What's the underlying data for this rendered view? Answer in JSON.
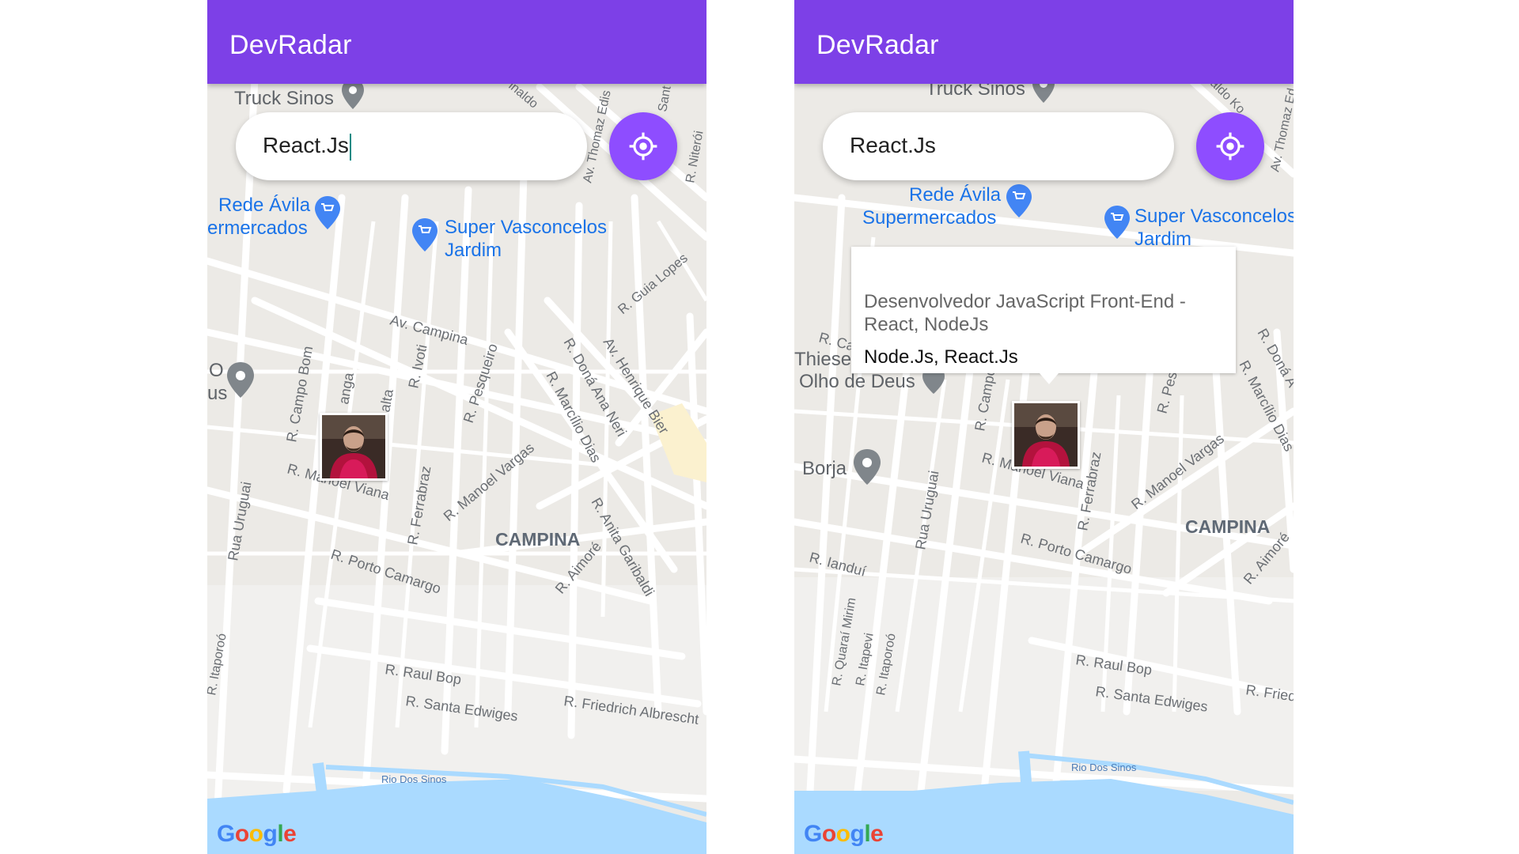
{
  "screens": [
    {
      "app_title": "DevRadar",
      "search_value": "React.Js",
      "search_focused": true,
      "map_labels": {
        "truck": "Truck Sinos",
        "rede_line1": "Rede Ávila",
        "rede_line2": "ermercados",
        "super_line1": "Super Vasconcelos",
        "super_line2": "Jardim",
        "av_campina": "Av. Campina",
        "campina": "CAMPINA",
        "porto_camargo": "R. Porto Camargo",
        "raul_bop": "R. Raul Bop",
        "santa_edwiges": "R. Santa Edwiges",
        "friedrich": "R. Friedrich Albrescht",
        "rio": "Rio Dos Sinos",
        "manoel_vargas": "R. Manoel Vargas",
        "guia_lopes": "R. Guia Lopes",
        "rua_uruguai": "Rua Uruguai",
        "campo_bom": "R. Campo Bom",
        "ferrabraz": "R. Ferrabraz",
        "pesqueiro": "R. Pesqueiro",
        "ivoti": "R. Ivoti",
        "dona_ana_neri": "R. Doná Ana Neri",
        "marcilio_dias": "R. Marcílio Dias",
        "henrique_bier": "Av. Henrique Bier",
        "anita_garibaldi": "R. Anita Garibaldi",
        "aimore": "R. Aimoré",
        "thomaz_edison": "Av. Thomaz Edis",
        "niteroi": "R. Niterói",
        "manoel_viana": "R. Manoel Viana",
        "taporoo": "R. Itaporoó",
        "olho_o": "O",
        "olho_us": "us",
        "anga": "anga",
        "alta": "alta",
        "sant": "Sant",
        "inaldo": "inaldo"
      }
    },
    {
      "app_title": "DevRadar",
      "search_value": "React.Js",
      "search_focused": false,
      "callout": {
        "bio": "Desenvolvedor JavaScript Front-End - React, NodeJs",
        "techs": "Node.Js, React.Js"
      },
      "map_labels": {
        "truck": "Truck Sinos",
        "rede_line1": "Rede Ávila",
        "rede_line2": "Supermercados",
        "super_line1": "Super Vasconcelos",
        "super_line2": "Jardim",
        "campina": "CAMPINA",
        "porto_camargo": "R. Porto Camargo",
        "raul_bop": "R. Raul Bop",
        "santa_edwiges": "R. Santa Edwiges",
        "rio": "Rio Dos Sinos",
        "manoel_vargas": "R. Manoel Vargas",
        "manoel_viana": "R. Manoel Viana",
        "rua_uruguai": "Rua Uruguai",
        "ferrabraz": "R. Ferrabraz",
        "landui": "R. Ianduí",
        "quarai_mirim": "R. Quaraí Mirim",
        "itapevi": "R. Itapevi",
        "itaporoo": "R. Itaporoó",
        "olho_de_deus": "Olho de Deus",
        "thiesen": "Thiesen",
        "borja": "Borja",
        "friedrich_short": "R. Fried",
        "aimore_short": "R. Aimoré",
        "dona_a": "R. Doná A",
        "marcilio_dias": "R. Marcílio Dias",
        "pes": "R. Pes",
        "campo": "R. Campo",
        "ca": "R. Ca",
        "thomaz": "Av. Thomaz Ed",
        "aldo": "aldo Ko"
      }
    }
  ],
  "google_logo": "Google",
  "colors": {
    "appbar": "#7d40e7",
    "locate_button": "#8e4dff",
    "map_background": "#eceae6",
    "road": "#ffffff",
    "water": "#aadaff",
    "poi_blue": "#4285f4",
    "pin_gray": "#80868b",
    "label_blue": "#1a73e8",
    "label_gray": "#5f6368"
  },
  "icons": [
    "gps-fixed-icon",
    "shopping-cart-pin-icon",
    "location-pin-icon",
    "dev-avatar-marker"
  ]
}
